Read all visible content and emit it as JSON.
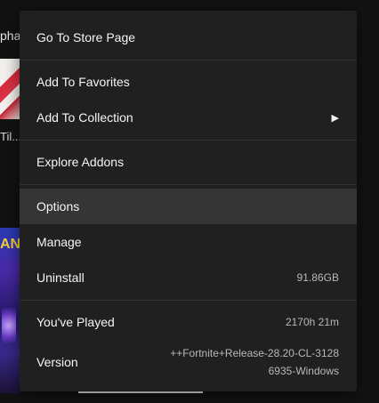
{
  "background": {
    "top_text": "pha",
    "mid_text": "Til...",
    "tile2_glyphs": "ANI QU"
  },
  "menu": {
    "store_page": "Go To Store Page",
    "add_favorites": "Add To Favorites",
    "add_collection": "Add To Collection",
    "add_collection_arrow": "▶",
    "explore_addons": "Explore Addons",
    "options": "Options",
    "manage": "Manage",
    "uninstall": "Uninstall",
    "uninstall_size": "91.86GB",
    "played": "You've Played",
    "played_time": "2170h 21m",
    "version": "Version",
    "version_value": "++Fortnite+Release-28.20-CL-31286935-Windows"
  },
  "colors": {
    "menu_bg": "#202020",
    "highlight_bg": "#353535",
    "separator": "#333333"
  }
}
